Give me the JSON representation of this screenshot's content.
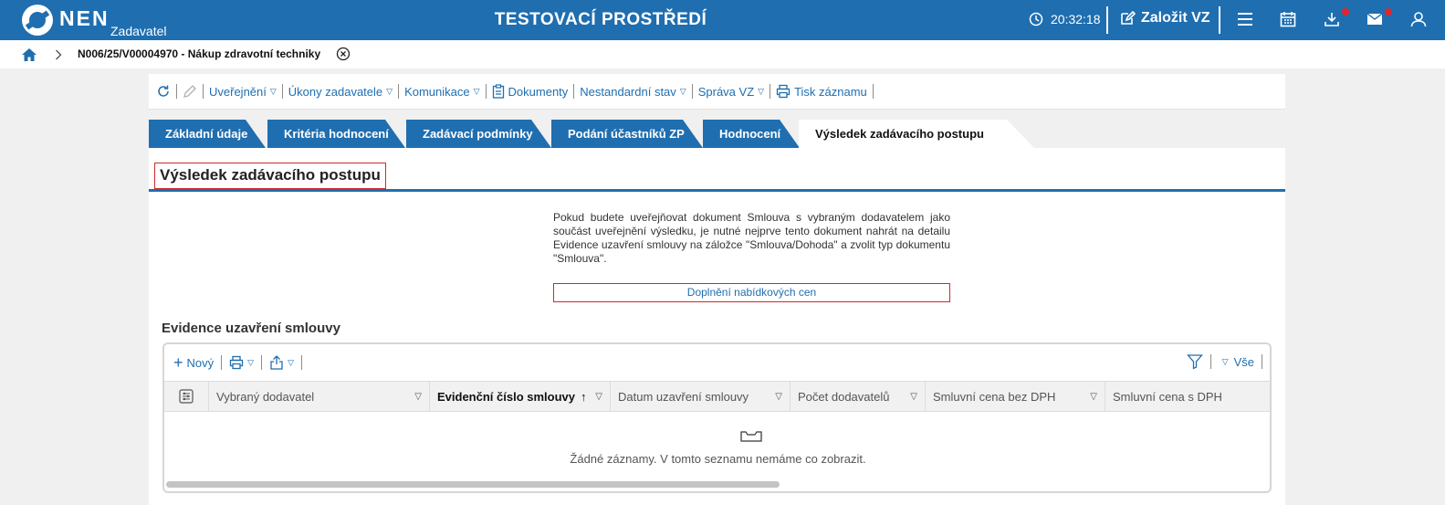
{
  "topbar": {
    "logo_text": "NEN",
    "logo_sub": "Zadavatel",
    "env_title": "TESTOVACÍ PROSTŘEDÍ",
    "time": "20:32:18",
    "create_label": "Založit VZ",
    "accent": "#1f6eb0",
    "notification_color": "#e0262c",
    "icons": [
      "clock-icon",
      "edit-icon",
      "menu-icon",
      "calendar-icon",
      "download-icon",
      "mail-icon",
      "user-icon"
    ]
  },
  "breadcrumb": {
    "text": "N006/25/V00004970 - Nákup zdravotní techniky"
  },
  "toolbar": {
    "items": [
      {
        "label": "Uveřejnění",
        "dropdown": true
      },
      {
        "label": "Úkony zadavatele",
        "dropdown": true
      },
      {
        "label": "Komunikace",
        "dropdown": true
      },
      {
        "label": "Dokumenty",
        "dropdown": false
      },
      {
        "label": "Nestandardní stav",
        "dropdown": true
      },
      {
        "label": "Správa VZ",
        "dropdown": true
      },
      {
        "label": "Tisk záznamu",
        "dropdown": false
      }
    ]
  },
  "tabs": [
    {
      "label": "Základní údaje"
    },
    {
      "label": "Kritéria hodnocení"
    },
    {
      "label": "Zadávací podmínky"
    },
    {
      "label": "Podání účastníků ZP"
    },
    {
      "label": "Hodnocení"
    },
    {
      "label": "Výsledek zadávacího postupu",
      "active": true
    }
  ],
  "main": {
    "section_title": "Výsledek zadávacího postupu",
    "notice": "Pokud budete uveřejňovat dokument Smlouva s vybraným dodavatelem jako součást uveřejnění výsledku, je nutné nejprve tento dokument nahrát na detailu Evidence uzavření smlouvy na záložce \"Smlouva/Dohoda\" a zvolit typ dokumentu \"Smlouva\".",
    "link_label": "Doplnění nabídkových cen",
    "grid_title": "Evidence uzavření smlouvy"
  },
  "grid": {
    "new_label": "Nový",
    "filter_all_label": "Vše",
    "columns": [
      {
        "label": "Vybraný dodavatel"
      },
      {
        "label": "Evidenční číslo smlouvy",
        "sorted": "asc"
      },
      {
        "label": "Datum uzavření smlouvy"
      },
      {
        "label": "Počet dodavatelů"
      },
      {
        "label": "Smluvní cena bez DPH"
      },
      {
        "label": "Smluvní cena s DPH"
      }
    ],
    "empty_text": "Žádné záznamy. V tomto seznamu nemáme co zobrazit."
  }
}
